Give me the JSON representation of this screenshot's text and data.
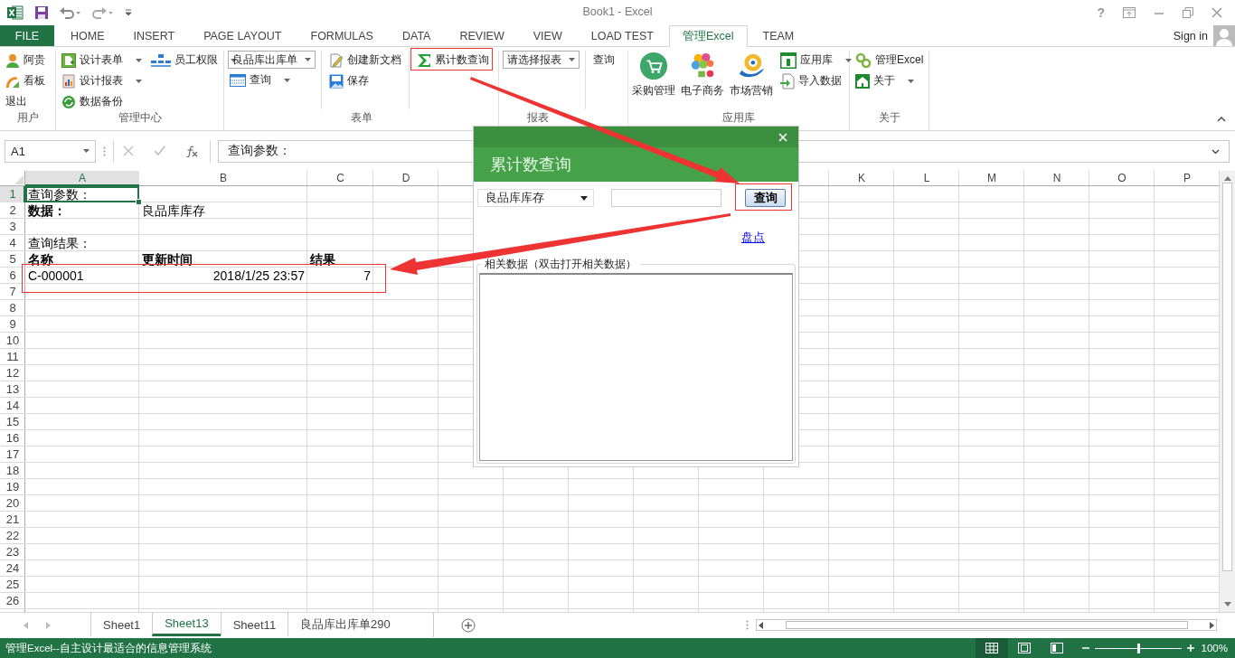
{
  "title_bar": {
    "title": "Book1 - Excel",
    "help": "?"
  },
  "ribbon_tabs": [
    {
      "label": "FILE",
      "kind": "file",
      "selected": false
    },
    {
      "label": "HOME",
      "kind": "tab",
      "selected": false
    },
    {
      "label": "INSERT",
      "kind": "tab",
      "selected": false
    },
    {
      "label": "PAGE LAYOUT",
      "kind": "tab",
      "selected": false
    },
    {
      "label": "FORMULAS",
      "kind": "tab",
      "selected": false
    },
    {
      "label": "DATA",
      "kind": "tab",
      "selected": false
    },
    {
      "label": "REVIEW",
      "kind": "tab",
      "selected": false
    },
    {
      "label": "VIEW",
      "kind": "tab",
      "selected": false
    },
    {
      "label": "LOAD TEST",
      "kind": "tab",
      "selected": false
    },
    {
      "label": "管理Excel",
      "kind": "tab",
      "selected": true
    },
    {
      "label": "TEAM",
      "kind": "tab",
      "selected": false
    }
  ],
  "account": {
    "label": "Sign in"
  },
  "ribbon_groups": [
    {
      "label": "用户",
      "column_dividers": false,
      "columns": [
        [
          {
            "kind": "small",
            "label": "阿贵",
            "menu": false
          },
          {
            "kind": "small",
            "label": "看板",
            "menu": false
          },
          {
            "kind": "plain",
            "label": "退出"
          }
        ]
      ]
    },
    {
      "label": "管理中心",
      "column_dividers": false,
      "columns": [
        [
          {
            "kind": "small",
            "label": "设计表单",
            "menu": true
          },
          {
            "kind": "small",
            "label": "设计报表",
            "menu": true
          },
          {
            "kind": "small",
            "label": "数据备份",
            "menu": false
          }
        ],
        [
          {
            "kind": "small",
            "label": "员工权限",
            "menu": true
          }
        ]
      ]
    },
    {
      "label": "表单",
      "column_dividers": true,
      "columns": [
        [
          {
            "kind": "dropdown",
            "label": "良品库出库单"
          },
          {
            "kind": "small",
            "label": "查询",
            "menu": true
          }
        ],
        [
          {
            "kind": "small",
            "label": "创建新文档",
            "menu": false
          },
          {
            "kind": "small",
            "label": "保存",
            "menu": false
          }
        ],
        [
          {
            "kind": "small",
            "label": "累计数查询",
            "menu": false
          }
        ]
      ]
    },
    {
      "label": "报表",
      "column_dividers": true,
      "columns": [
        [
          {
            "kind": "dropdown",
            "label": "请选择报表"
          }
        ],
        [
          {
            "kind": "plain",
            "label": "查询"
          }
        ]
      ]
    },
    {
      "label": "应用库",
      "column_dividers": false,
      "columns": [
        [
          {
            "kind": "large",
            "label": "采购管理"
          }
        ],
        [
          {
            "kind": "large",
            "label": "电子商务"
          }
        ],
        [
          {
            "kind": "large",
            "label": "市场营销"
          }
        ],
        [
          {
            "kind": "small",
            "label": "应用库",
            "menu": true
          },
          {
            "kind": "small",
            "label": "导入数据",
            "menu": false
          }
        ]
      ]
    },
    {
      "label": "关于",
      "column_dividers": false,
      "columns": [
        [
          {
            "kind": "small",
            "label": "管理Excel",
            "menu": false
          },
          {
            "kind": "small",
            "label": "关于",
            "menu": true
          }
        ]
      ]
    }
  ],
  "formula_bar": {
    "name_box": "A1",
    "formula": "查询参数："
  },
  "sheet": {
    "columns": [
      {
        "label": "A"
      },
      {
        "label": "B"
      },
      {
        "label": "C"
      },
      {
        "label": "D"
      },
      {},
      {},
      {},
      {},
      {},
      {},
      {
        "label": "K"
      },
      {
        "label": "L"
      },
      {
        "label": "M"
      },
      {
        "label": "N"
      },
      {
        "label": "O"
      },
      {
        "label": "P"
      }
    ],
    "rows": [
      {
        "label": "1",
        "cells": [
          {
            "text": "查询参数：",
            "kind": "text",
            "bold": false,
            "active": true
          }
        ]
      },
      {
        "label": "2",
        "cells": [
          {
            "text": "数据：",
            "kind": "text",
            "bold": true,
            "active": false
          },
          {
            "text": "良品库库存",
            "kind": "text",
            "bold": false,
            "active": false
          }
        ]
      },
      {
        "label": "3"
      },
      {
        "label": "4",
        "cells": [
          {
            "text": "查询结果：",
            "kind": "text",
            "bold": false,
            "active": false
          }
        ]
      },
      {
        "label": "5",
        "cells": [
          {
            "text": "名称",
            "kind": "text",
            "bold": true,
            "active": false
          },
          {
            "text": "更新时间",
            "kind": "text",
            "bold": true,
            "active": false
          },
          {
            "text": "结果",
            "kind": "text",
            "bold": true,
            "active": false
          }
        ]
      },
      {
        "label": "6",
        "cells": [
          {
            "text": "C-000001",
            "kind": "text",
            "bold": false,
            "active": false
          },
          {
            "text": "2018/1/25 23:57",
            "kind": "number",
            "bold": false,
            "active": false
          },
          {
            "text": "7",
            "kind": "number",
            "bold": false,
            "active": false
          }
        ]
      },
      {
        "label": "7"
      },
      {
        "label": "8"
      },
      {
        "label": "9"
      },
      {
        "label": "10"
      },
      {
        "label": "11"
      },
      {
        "label": "12"
      },
      {
        "label": "13"
      },
      {
        "label": "14"
      },
      {
        "label": "15"
      },
      {
        "label": "16"
      },
      {
        "label": "17"
      },
      {
        "label": "18"
      },
      {
        "label": "19"
      },
      {
        "label": "20"
      },
      {
        "label": "21"
      },
      {
        "label": "22"
      },
      {
        "label": "23"
      },
      {
        "label": "24"
      },
      {
        "label": "25"
      },
      {
        "label": "26"
      }
    ]
  },
  "sheet_tabs": [
    {
      "label": "Sheet1",
      "selected": false
    },
    {
      "label": "Sheet13",
      "selected": true
    },
    {
      "label": "Sheet11",
      "selected": false
    },
    {
      "label": "良品库出库单290",
      "selected": false
    }
  ],
  "status_bar": {
    "message": "管理Excel--自主设计最适合的信息管理系统",
    "views": [
      {
        "kind": "normal",
        "selected": true
      },
      {
        "kind": "page_layout",
        "selected": false
      },
      {
        "kind": "page_break",
        "selected": false
      }
    ],
    "zoom": {
      "level": 0.5,
      "reading": "100%"
    }
  },
  "dialog": {
    "title": "累计数查询",
    "select_value": "良品库库存",
    "button": "查询",
    "link": "盘点",
    "group_label": "相关数据（双击打开相关数据）"
  }
}
